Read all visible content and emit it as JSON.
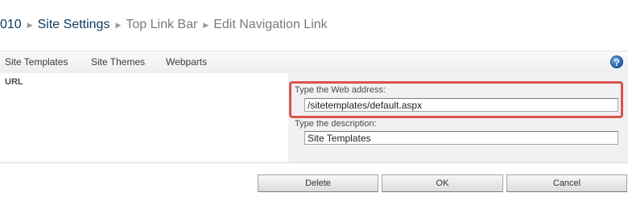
{
  "breadcrumb": {
    "root": "010",
    "site_settings": "Site Settings",
    "top_link_bar": "Top Link Bar",
    "current": "Edit Navigation Link"
  },
  "nav": {
    "items": [
      "Site Templates",
      "Site Themes",
      "Webparts"
    ],
    "help": "?"
  },
  "form": {
    "url_label": "URL",
    "web_address_label": "Type the Web address:",
    "web_address_value": "/sitetemplates/default.aspx",
    "description_label": "Type the description:",
    "description_value": "Site Templates"
  },
  "buttons": {
    "delete": "Delete",
    "ok": "OK",
    "cancel": "Cancel"
  },
  "colors": {
    "highlight": "#d9534f",
    "breadcrumb_dark": "#0f3b61",
    "breadcrumb_light": "#7a7a7a"
  }
}
